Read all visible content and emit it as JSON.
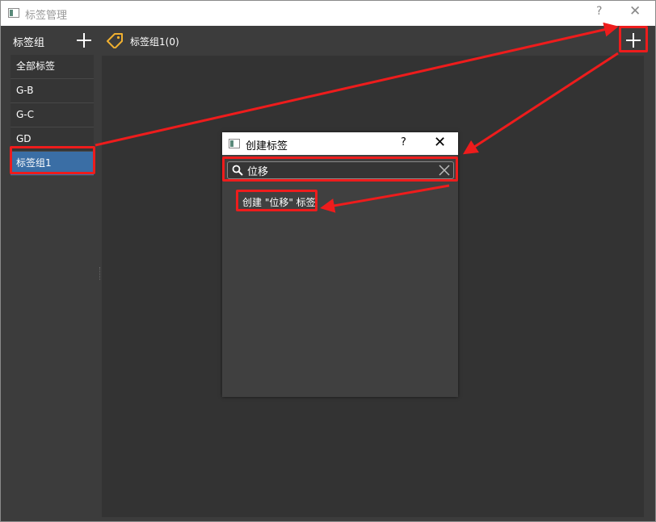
{
  "window": {
    "title": "标签管理",
    "help": "?",
    "close": "✕"
  },
  "header": {
    "group_label": "标签组",
    "current_group": "标签组1(0)"
  },
  "sidebar": {
    "items": [
      {
        "label": "全部标签"
      },
      {
        "label": "G-B"
      },
      {
        "label": "G-C"
      },
      {
        "label": "GD"
      },
      {
        "label": "标签组1"
      }
    ],
    "selected": "标签组1"
  },
  "dialog": {
    "title": "创建标签",
    "help": "?",
    "close": "✕",
    "search_value": "位移",
    "result": "创建 \"位移\" 标签"
  },
  "colors": {
    "accent": "#3a6ea5",
    "highlight": "#ee1c1c",
    "tag_icon": "#f0b030"
  }
}
